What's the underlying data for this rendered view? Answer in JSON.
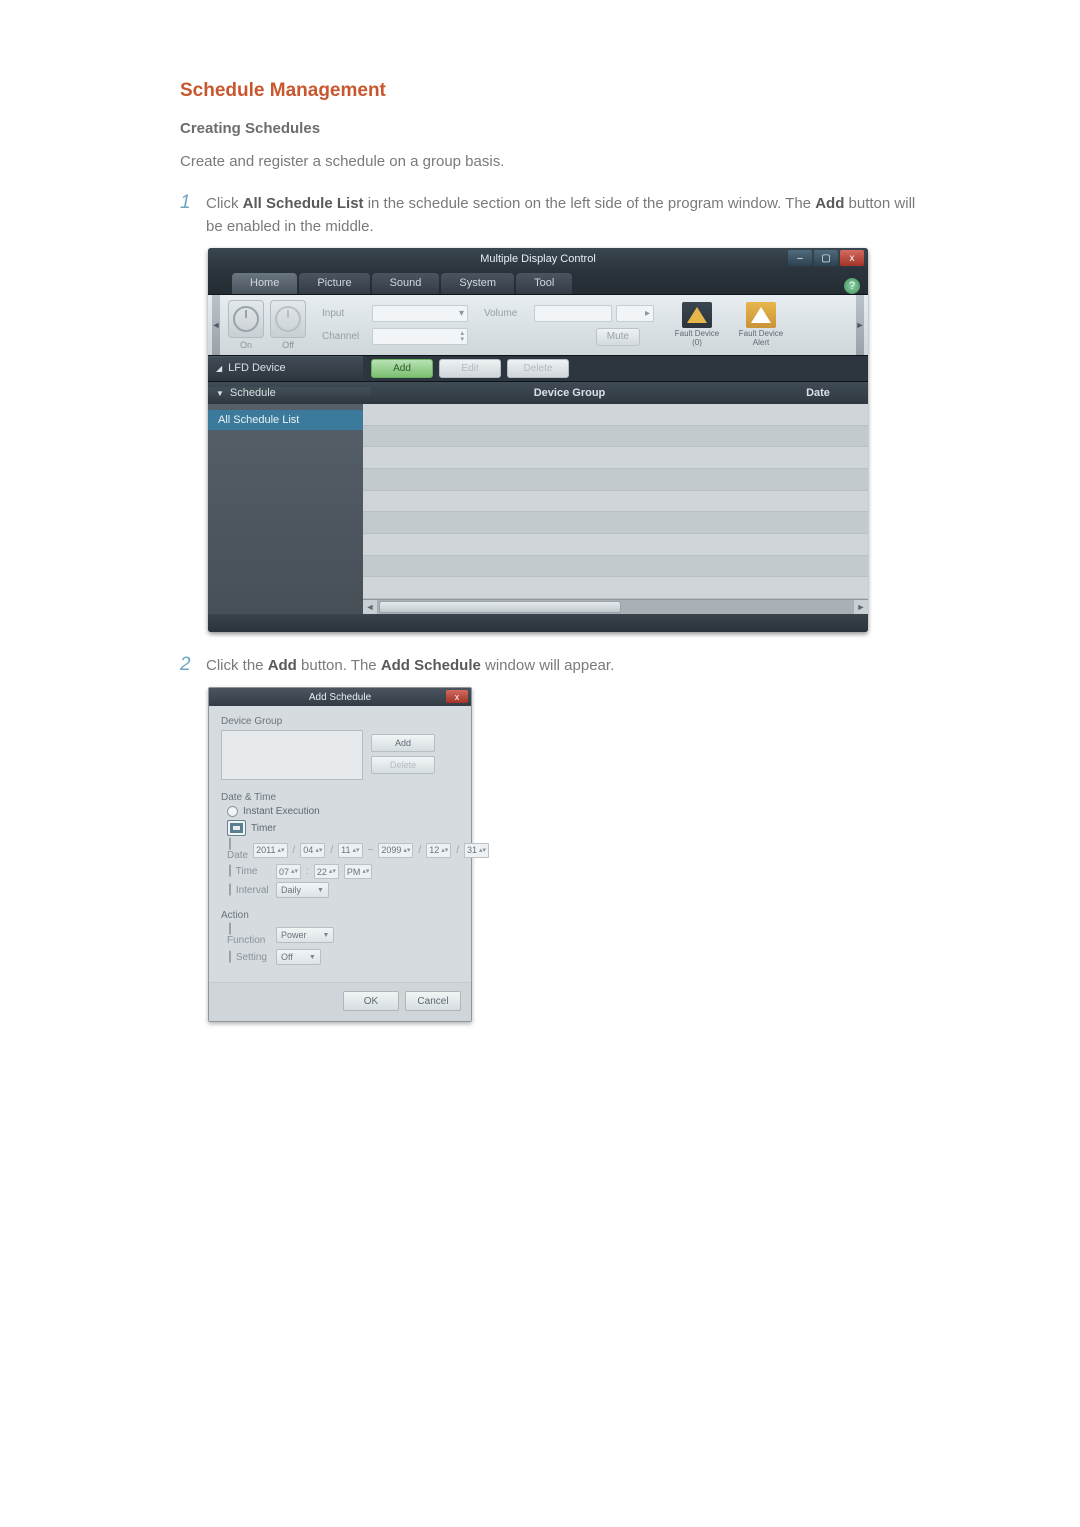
{
  "doc": {
    "section_title": "Schedule Management",
    "sub_heading": "Creating Schedules",
    "intro": "Create and register a schedule on a group basis.",
    "steps": [
      {
        "num": "1",
        "pre": "Click ",
        "b1": "All Schedule List",
        "mid": " in the schedule section on the left side of the program window. The ",
        "b2": "Add",
        "post": " button will be enabled in the middle."
      },
      {
        "num": "2",
        "pre": "Click the ",
        "b1": "Add",
        "mid": " button. The ",
        "b2": "Add Schedule",
        "post": " window will appear."
      }
    ]
  },
  "shot1": {
    "title": "Multiple Display Control",
    "help": "?",
    "win": {
      "min": "–",
      "max": "▢",
      "close": "x"
    },
    "tabs": [
      "Home",
      "Picture",
      "Sound",
      "System",
      "Tool"
    ],
    "ribbon": {
      "on": "On",
      "off": "Off",
      "input": "Input",
      "channel": "Channel",
      "volume": "Volume",
      "mute": "Mute",
      "fault_device": "Fault Device",
      "fault_count": "(0)",
      "fault_alert": "Fault Device Alert"
    },
    "mid": {
      "left": "LFD Device",
      "add": "Add",
      "edit": "Edit",
      "delete": "Delete"
    },
    "cols": {
      "schedule": "Schedule",
      "group": "Device Group",
      "date": "Date"
    },
    "side_item": "All Schedule List"
  },
  "shot2": {
    "title": "Add Schedule",
    "close": "x",
    "group": {
      "label": "Device Group",
      "add": "Add",
      "delete": "Delete"
    },
    "dt": {
      "label": "Date & Time",
      "instant": "Instant Execution",
      "timer": "Timer",
      "date_lbl": "Date",
      "date_from": [
        "2011",
        "04",
        "11"
      ],
      "tilde": "~",
      "date_to": [
        "2099",
        "12",
        "31"
      ],
      "time_lbl": "Time",
      "time": [
        "07",
        "22",
        "PM"
      ],
      "interval_lbl": "Interval",
      "interval": "Daily"
    },
    "action": {
      "label": "Action",
      "function_lbl": "Function",
      "function": "Power",
      "setting_lbl": "Setting",
      "setting": "Off"
    },
    "ok": "OK",
    "cancel": "Cancel"
  }
}
